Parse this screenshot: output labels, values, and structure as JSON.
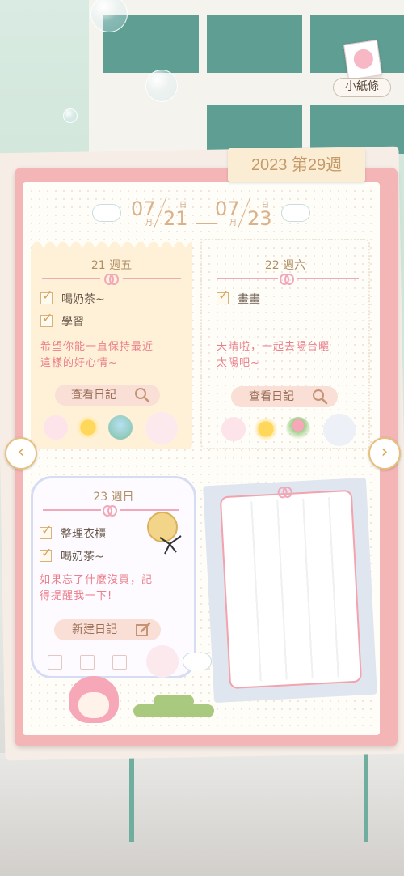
{
  "note_button": {
    "label": "小紙條"
  },
  "week_tag": "2023 第29週",
  "date_range": {
    "start_month": "07",
    "start_day": "21",
    "end_month": "07",
    "end_day": "23",
    "month_char": "月",
    "day_char": "日"
  },
  "days": [
    {
      "title": "21 週五",
      "checklist": [
        "喝奶茶~",
        "學習"
      ],
      "diary_lines": [
        "希望你能一直保持最近",
        "這樣的好心情~"
      ],
      "button_label": "查看日記"
    },
    {
      "title": "22 週六",
      "checklist": [
        "畫畫"
      ],
      "diary_lines": [
        "天晴啦，一起去陽台曬",
        "太陽吧~"
      ],
      "button_label": "查看日記"
    },
    {
      "title": "23 週日",
      "checklist": [
        "整理衣櫃",
        "喝奶茶~"
      ],
      "diary_lines": [
        "如果忘了什麼沒買，記",
        "得提醒我一下!"
      ],
      "button_label": "新建日記"
    }
  ],
  "icons": {
    "prev": "chevron-left-icon",
    "next": "chevron-right-icon",
    "search": "search-icon",
    "edit": "edit-icon"
  },
  "colors": {
    "frame": "#f3b5b5",
    "accent_text": "#ea7f8b",
    "date_text": "#d9b18a",
    "tag_text": "#c69a68"
  }
}
